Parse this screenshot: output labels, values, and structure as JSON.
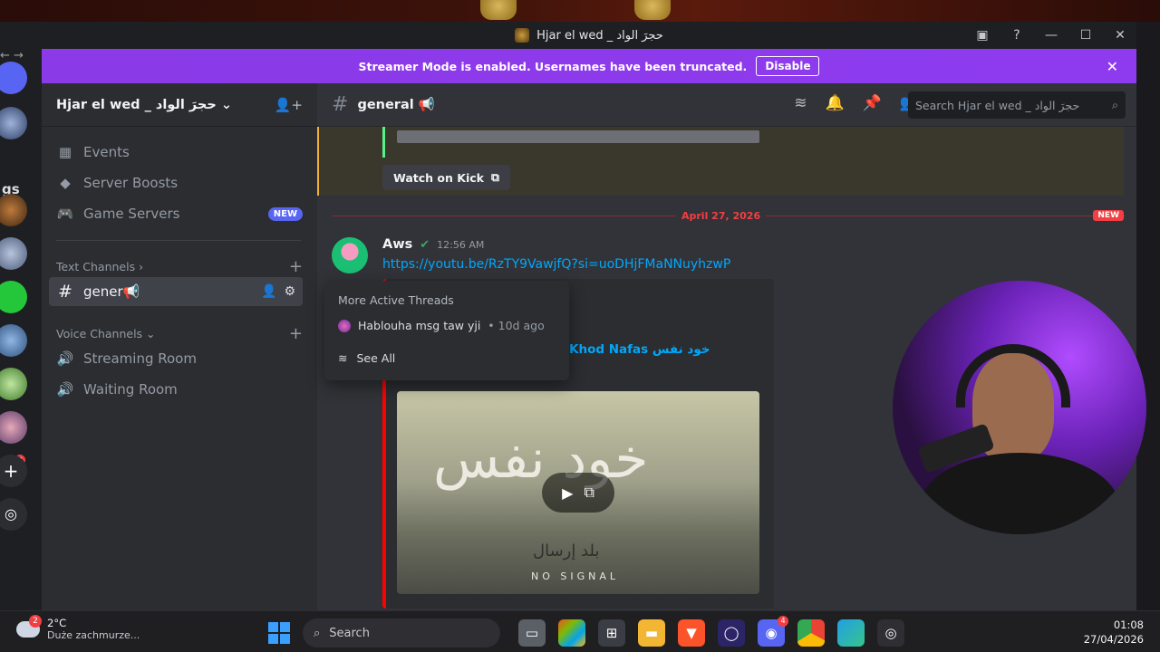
{
  "window": {
    "title": "Hjar el wed _ حجرَ الواد",
    "controls": [
      "inbox-icon",
      "help-icon",
      "minimize-icon",
      "maximize-icon",
      "close-icon"
    ]
  },
  "banner": {
    "message": "Streamer Mode is enabled. Usernames have been truncated.",
    "disable_label": "Disable"
  },
  "rail": {
    "partial_label": "gs",
    "badge": "4"
  },
  "server": {
    "name": "Hjar el wed _ حجرَ الواد"
  },
  "sidebar": {
    "items": [
      {
        "label": "Events",
        "icon": "calendar-icon"
      },
      {
        "label": "Server Boosts",
        "icon": "boost-icon"
      },
      {
        "label": "Game Servers",
        "icon": "gamepad-icon",
        "badge": "NEW"
      }
    ],
    "text_category": "Text Channels",
    "text_channels": [
      {
        "label": "gener",
        "emoji": "📢"
      }
    ],
    "voice_category": "Voice Channels",
    "voice_channels": [
      {
        "label": "Streaming Room"
      },
      {
        "label": "Waiting Room"
      }
    ]
  },
  "chat": {
    "channel_name": "general",
    "channel_emoji": "📢",
    "search_placeholder": "Search Hjar el wed _ حجرَ الواد",
    "watch_label": "Watch on Kick",
    "date_divider": "April 27, 2026",
    "new_label": "NEW",
    "message": {
      "author": "Aws",
      "timestamp": "12:56 AM",
      "link": "https://youtu.be/RzTY9VawjfQ?si=uoDHjFMaNNuyhzwP",
      "embed_title": "Khod Nafas خود نفس",
      "thumb_big": "خود نفس",
      "thumb_sub1": "بلد إرسال",
      "thumb_sub2": "NO SIGNAL"
    }
  },
  "threads_popup": {
    "header": "More Active Threads",
    "thread_name": "Hablouha msg taw yji",
    "thread_age": "10d ago",
    "see_all": "See All"
  },
  "taskbar": {
    "weather_temp": "2°C",
    "weather_desc": "Duże zachmurze...",
    "weather_badge": "2",
    "search_label": "Search",
    "discord_badge": "4",
    "time": "01:08",
    "date": "27/04/2026"
  },
  "colors": {
    "accent": "#8e3bf0",
    "blurple": "#5865f2",
    "danger": "#f23f43",
    "link": "#00a8fc"
  }
}
